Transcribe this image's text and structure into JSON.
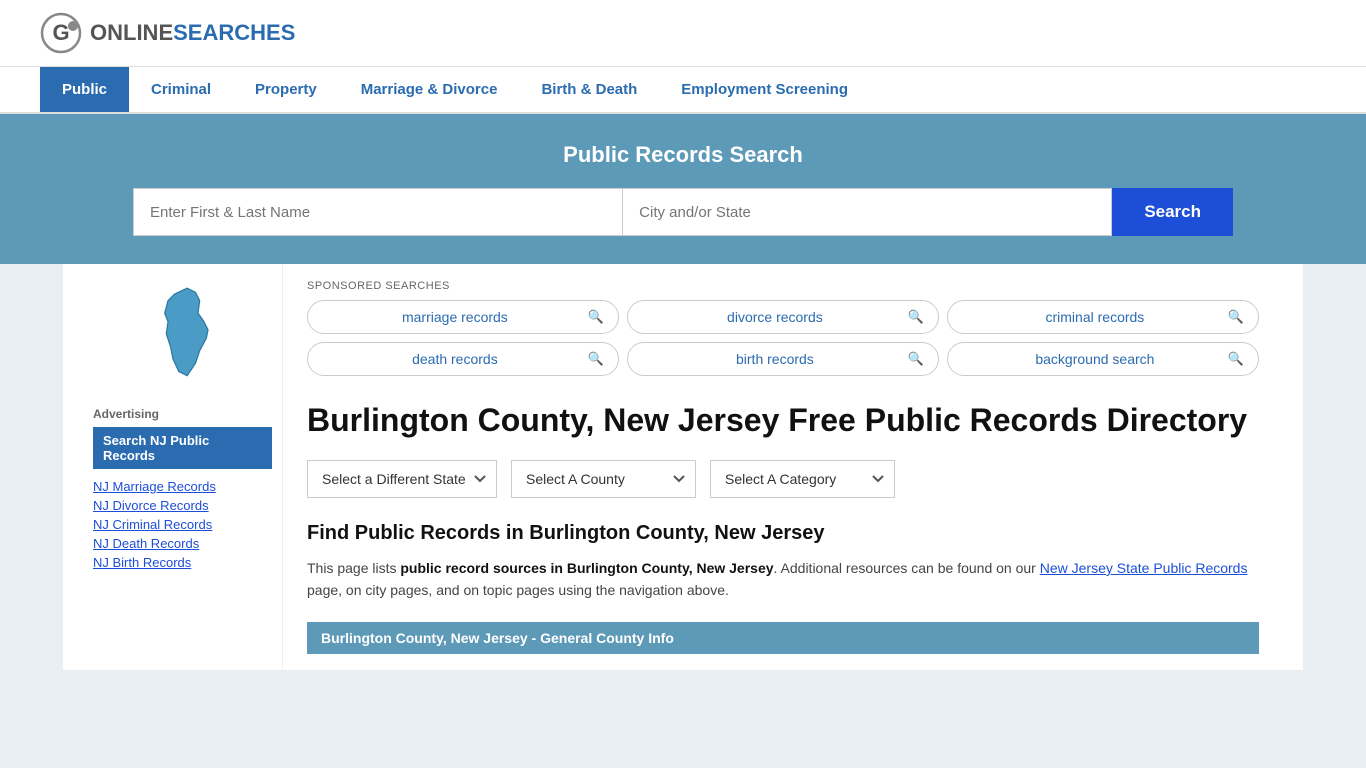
{
  "logo": {
    "online": "ONLINE",
    "searches": "SEARCHES"
  },
  "nav": {
    "items": [
      {
        "label": "Public",
        "active": true
      },
      {
        "label": "Criminal",
        "active": false
      },
      {
        "label": "Property",
        "active": false
      },
      {
        "label": "Marriage & Divorce",
        "active": false
      },
      {
        "label": "Birth & Death",
        "active": false
      },
      {
        "label": "Employment Screening",
        "active": false
      }
    ]
  },
  "search_banner": {
    "title": "Public Records Search",
    "name_placeholder": "Enter First & Last Name",
    "location_placeholder": "City and/or State",
    "button_label": "Search"
  },
  "sponsored": {
    "label": "SPONSORED SEARCHES",
    "pills": [
      {
        "text": "marriage records"
      },
      {
        "text": "divorce records"
      },
      {
        "text": "criminal records"
      },
      {
        "text": "death records"
      },
      {
        "text": "birth records"
      },
      {
        "text": "background search"
      }
    ]
  },
  "page_title": "Burlington County, New Jersey Free Public Records Directory",
  "dropdowns": {
    "state_label": "Select a Different State",
    "county_label": "Select A County",
    "category_label": "Select A Category"
  },
  "find_section": {
    "heading": "Find Public Records in Burlington County, New Jersey",
    "description_start": "This page lists ",
    "description_bold": "public record sources in Burlington County, New Jersey",
    "description_mid": ". Additional resources can be found on our ",
    "link_text": "New Jersey State Public Records",
    "description_end": " page, on city pages, and on topic pages using the navigation above."
  },
  "info_bar": {
    "text": "Burlington County, New Jersey - General County Info"
  },
  "sidebar": {
    "advertising_label": "Advertising",
    "promo_button": "Search NJ Public Records",
    "links": [
      "NJ Marriage Records",
      "NJ Divorce Records",
      "NJ Criminal Records",
      "NJ Death Records",
      "NJ Birth Records"
    ]
  }
}
